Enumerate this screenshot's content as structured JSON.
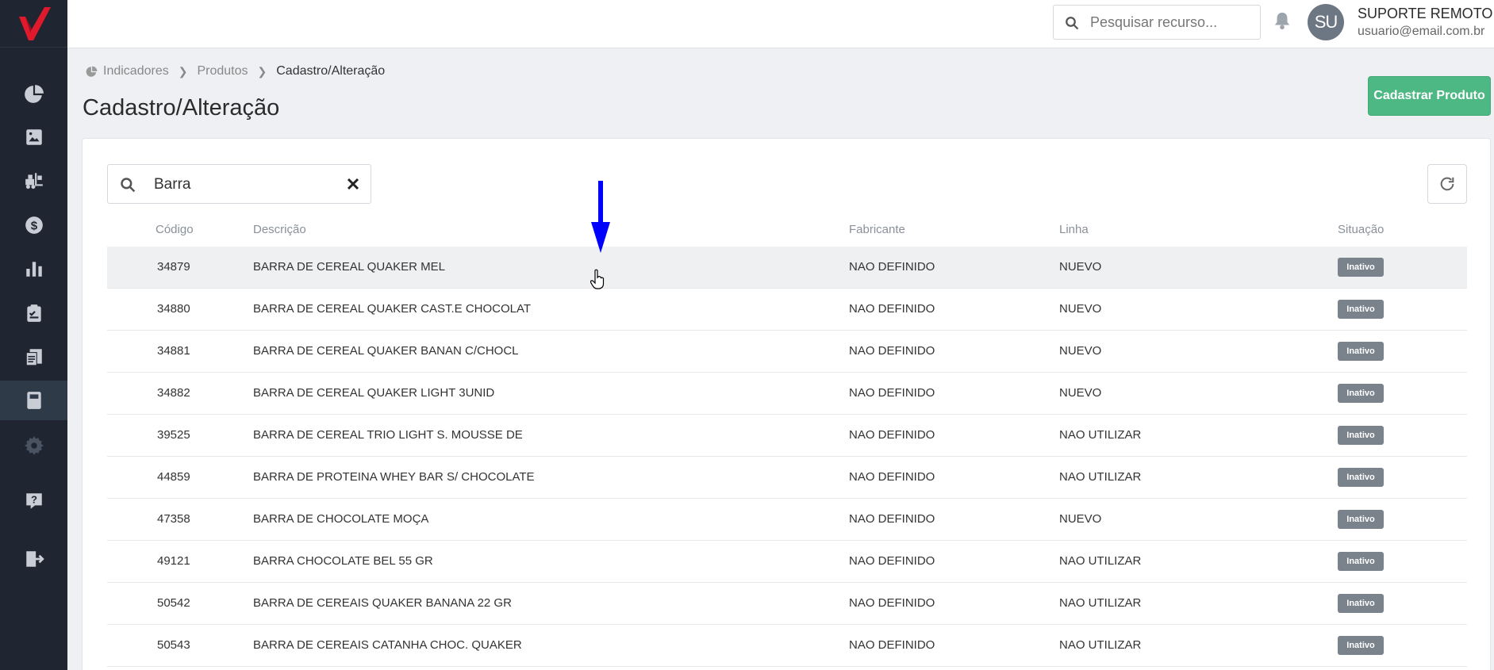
{
  "topbar": {
    "search_placeholder": "Pesquisar recurso...",
    "user_initials": "SU",
    "user_name": "SUPORTE REMOTO",
    "user_email": "usuario@email.com.br"
  },
  "sidebar": {
    "items": [
      {
        "icon": "chart-pie-icon"
      },
      {
        "icon": "image-icon"
      },
      {
        "icon": "forklift-icon"
      },
      {
        "icon": "dollar-icon"
      },
      {
        "icon": "bar-chart-icon"
      },
      {
        "icon": "clipboard-icon"
      },
      {
        "icon": "invoice-icon"
      },
      {
        "icon": "book-icon",
        "active": true
      },
      {
        "icon": "gear-icon"
      },
      {
        "icon": "help-icon"
      },
      {
        "icon": "logout-icon"
      }
    ]
  },
  "breadcrumb": {
    "items": [
      "Indicadores",
      "Produtos",
      "Cadastro/Alteração"
    ]
  },
  "page": {
    "title": "Cadastro/Alteração",
    "primary_button": "Cadastrar Produto"
  },
  "filter": {
    "value": "Barra"
  },
  "table": {
    "headers": {
      "code": "Código",
      "description": "Descrição",
      "manufacturer": "Fabricante",
      "line": "Linha",
      "status": "Situação"
    },
    "rows": [
      {
        "code": "34879",
        "description": "BARRA DE CEREAL QUAKER MEL",
        "manufacturer": "NAO DEFINIDO",
        "line": "NUEVO",
        "status": "Inativo"
      },
      {
        "code": "34880",
        "description": "BARRA DE CEREAL QUAKER CAST.E CHOCOLAT",
        "manufacturer": "NAO DEFINIDO",
        "line": "NUEVO",
        "status": "Inativo"
      },
      {
        "code": "34881",
        "description": "BARRA DE CEREAL QUAKER BANAN C/CHOCL",
        "manufacturer": "NAO DEFINIDO",
        "line": "NUEVO",
        "status": "Inativo"
      },
      {
        "code": "34882",
        "description": "BARRA DE CEREAL QUAKER LIGHT 3UNID",
        "manufacturer": "NAO DEFINIDO",
        "line": "NUEVO",
        "status": "Inativo"
      },
      {
        "code": "39525",
        "description": "BARRA DE CEREAL TRIO LIGHT S. MOUSSE DE",
        "manufacturer": "NAO DEFINIDO",
        "line": "NAO UTILIZAR",
        "status": "Inativo"
      },
      {
        "code": "44859",
        "description": "BARRA DE PROTEINA WHEY BAR S/ CHOCOLATE",
        "manufacturer": "NAO DEFINIDO",
        "line": "NAO UTILIZAR",
        "status": "Inativo"
      },
      {
        "code": "47358",
        "description": "BARRA DE CHOCOLATE MOÇA",
        "manufacturer": "NAO DEFINIDO",
        "line": "NUEVO",
        "status": "Inativo"
      },
      {
        "code": "49121",
        "description": "BARRA CHOCOLATE BEL 55 GR",
        "manufacturer": "NAO DEFINIDO",
        "line": "NAO UTILIZAR",
        "status": "Inativo"
      },
      {
        "code": "50542",
        "description": "BARRA DE CEREAIS QUAKER BANANA 22 GR",
        "manufacturer": "NAO DEFINIDO",
        "line": "NAO UTILIZAR",
        "status": "Inativo"
      },
      {
        "code": "50543",
        "description": "BARRA DE CEREAIS CATANHA CHOC. QUAKER",
        "manufacturer": "NAO DEFINIDO",
        "line": "NAO UTILIZAR",
        "status": "Inativo"
      }
    ]
  },
  "colors": {
    "sidebar_bg": "#1f2631",
    "accent_green": "#4db883",
    "logo_red": "#e0192d",
    "badge_gray": "#7a828c",
    "annotation_blue": "#0000ff"
  }
}
